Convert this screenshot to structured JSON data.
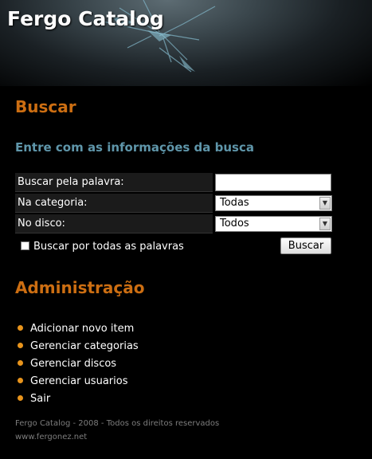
{
  "header": {
    "title": "Fergo Catalog"
  },
  "search": {
    "heading": "Buscar",
    "subheading": "Entre com as informações da busca",
    "word_label": "Buscar pela palavra:",
    "word_value": "",
    "category_label": "Na categoria:",
    "category_value": "Todas",
    "disc_label": "No disco:",
    "disc_value": "Todos",
    "all_words_label": "Buscar por todas as palavras",
    "all_words_checked": false,
    "button_label": "Buscar"
  },
  "admin": {
    "heading": "Administração",
    "items": [
      {
        "label": "Adicionar novo item"
      },
      {
        "label": "Gerenciar categorias"
      },
      {
        "label": "Gerenciar discos"
      },
      {
        "label": "Gerenciar usuarios"
      },
      {
        "label": "Sair"
      }
    ]
  },
  "footer": {
    "copyright": "Fergo Catalog - 2008 - Todos os direitos reservados",
    "site": "www.fergonez.net"
  },
  "colors": {
    "heading": "#cc6e12",
    "subheading": "#5f96aa",
    "bullet": "#e8941c",
    "background": "#000000"
  }
}
